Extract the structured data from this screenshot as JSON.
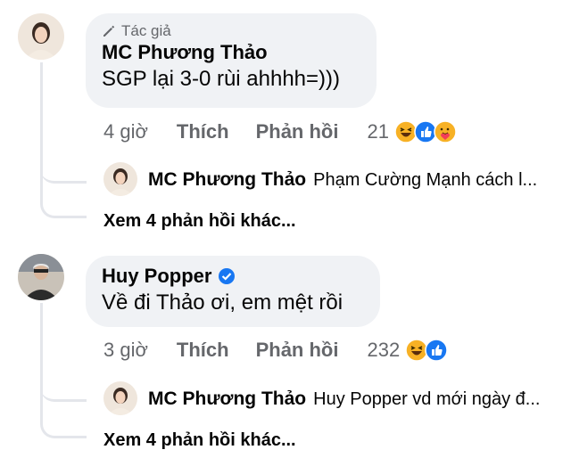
{
  "comments": [
    {
      "author_badge": "Tác giả",
      "name": "MC Phương Thảo",
      "text": "SGP lại 3-0 rùi ahhhh=)))",
      "time": "4 giờ",
      "like": "Thích",
      "reply": "Phản hồi",
      "reactions_count": "21",
      "reactions": [
        "haha-icon",
        "like-icon",
        "care-icon"
      ],
      "reply_preview": {
        "name": "MC Phương Thảo",
        "text": "Phạm Cường Mạnh cách l..."
      },
      "more_replies": "Xem 4 phản hồi khác..."
    },
    {
      "name": "Huy Popper",
      "verified": true,
      "text": "Về đi Thảo ơi, em mệt rồi",
      "time": "3 giờ",
      "like": "Thích",
      "reply": "Phản hồi",
      "reactions_count": "232",
      "reactions": [
        "haha-icon",
        "like-icon"
      ],
      "reply_preview": {
        "name": "MC Phương Thảo",
        "text": "Huy Popper vd mới ngày đ..."
      },
      "more_replies": "Xem 4 phản hồi khác..."
    }
  ],
  "colors": {
    "bubble": "#f0f2f5",
    "secondary_text": "#65676b",
    "thread_line": "#e4e6eb",
    "like_blue": "#1877f2",
    "haha_yellow": "#f7b125"
  }
}
